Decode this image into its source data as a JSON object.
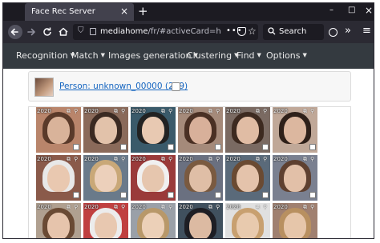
{
  "browser": {
    "tab_title": "Face Rec Server",
    "close_tab": "×",
    "new_tab": "+",
    "window_controls": {
      "minimize": "–",
      "maximize": "□",
      "close": "×"
    },
    "url_host": "mediahome",
    "url_path": "/fr/#activeCard=headi",
    "url_more": "•••",
    "search_placeholder": "Search",
    "overflow": "»",
    "menu": "≡"
  },
  "nav": {
    "items": [
      {
        "label": "Recognition"
      },
      {
        "label": "Match"
      },
      {
        "label": "Images generation"
      },
      {
        "label": "Clustering"
      },
      {
        "label": "Find"
      },
      {
        "label": "Options"
      }
    ]
  },
  "card": {
    "person_label": "Person: unknown_00000 (209)"
  },
  "thumbnails": {
    "year": "2020",
    "rows": [
      {
        "images": [
          "girl-dark-hair-1",
          "girl-dark-hair-2",
          "child-dark-hoodie",
          "girl-dark-hair-3",
          "girl-dark-hair-4",
          "girl-dark-hair-5"
        ]
      },
      {
        "images": [
          "child-white-hood-1",
          "child-blond-1",
          "child-white-hood-2",
          "child-brown-hair-1",
          "child-brown-hair-2",
          "child-brown-hair-3"
        ]
      },
      {
        "images": [
          "child-brown-hair-4",
          "child-white-hood-3",
          "child-blond-2",
          "child-dark-hoodie-2",
          "child-blond-3",
          "child-blond-4"
        ]
      }
    ]
  },
  "colors": {
    "tab_strip": "#1c1b22",
    "toolbar": "#2b2a33",
    "navbar": "#343a40",
    "link": "#1565c0"
  }
}
